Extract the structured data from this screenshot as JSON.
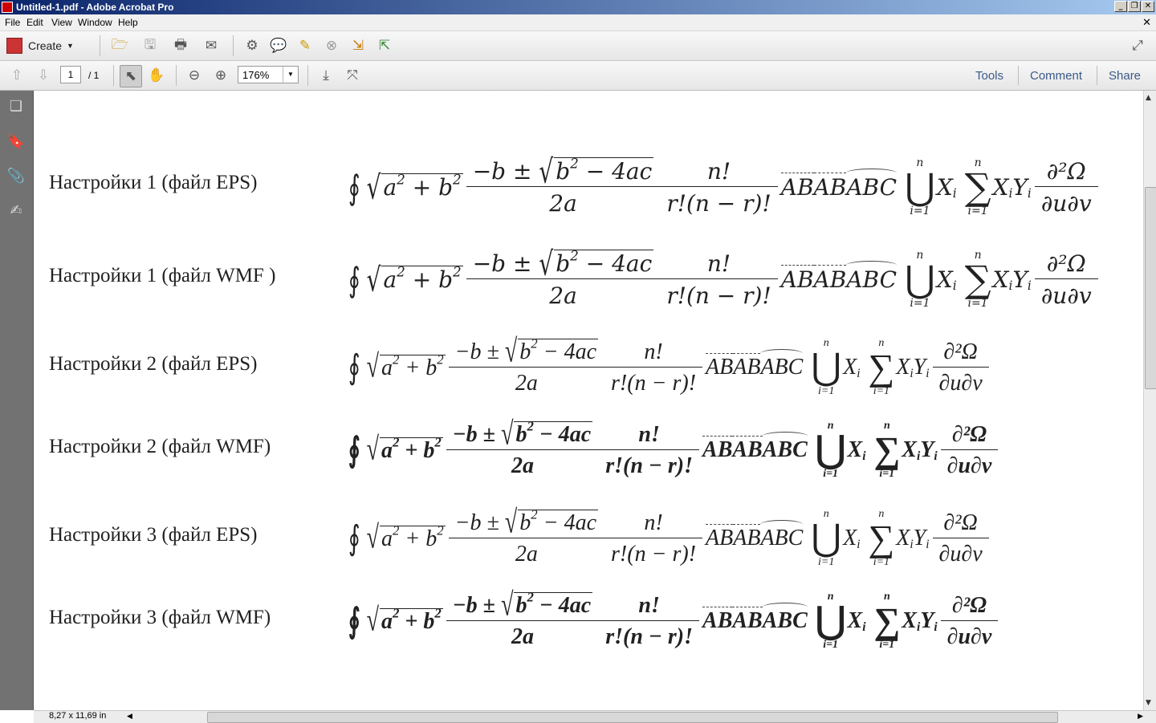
{
  "window": {
    "title": "Untitled-1.pdf - Adobe Acrobat Pro"
  },
  "menu": {
    "items": [
      "File",
      "Edit",
      "View",
      "Window",
      "Help"
    ]
  },
  "toolbar1": {
    "create_label": "Create"
  },
  "toolbar2": {
    "page_current": "1",
    "page_total": "/ 1",
    "zoom": "176%",
    "tools_label": "Tools",
    "comment_label": "Comment",
    "share_label": "Share"
  },
  "status": {
    "page_size": "8,27 x 11,69 in"
  },
  "document": {
    "rows": [
      {
        "label": "Настройки 1 (файл EPS)"
      },
      {
        "label": "Настройки 1 (файл WMF )"
      },
      {
        "label": "Настройки 2 (файл EPS)"
      },
      {
        "label": "Настройки 2 (файл WMF)"
      },
      {
        "label": "Настройки 3 (файл EPS)"
      },
      {
        "label": "Настройки 3 (файл WMF)"
      }
    ],
    "formula": {
      "a": "a",
      "b": "b",
      "two": "2",
      "pm": "−b ±",
      "four_ac": "− 4ac",
      "two_a": "2a",
      "n_fact": "n!",
      "r_fact": "r!",
      "n_minus_r": "(n − r)!",
      "ab": "AB",
      "abc": "ABC",
      "n": "n",
      "i_eq_1": "i=1",
      "x": "X",
      "y": "Y",
      "i": "i",
      "partial_num": "∂²Ω",
      "partial_den": "∂u∂v"
    }
  }
}
